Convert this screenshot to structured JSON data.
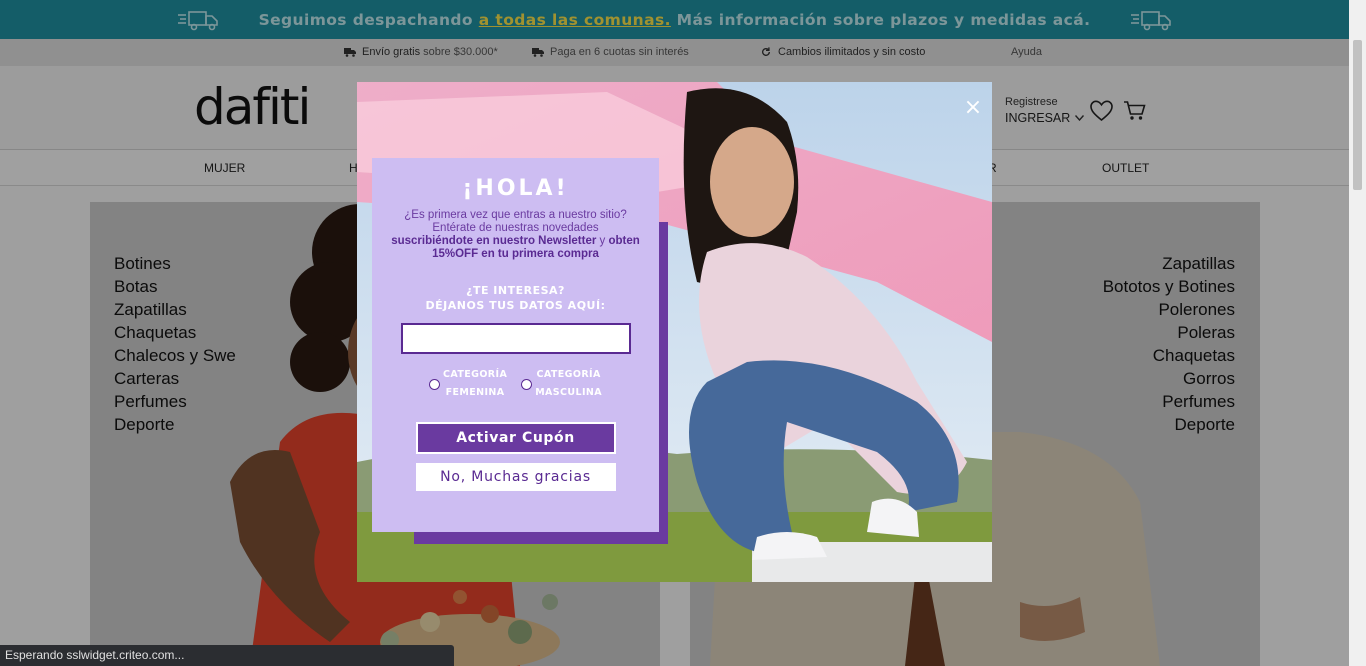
{
  "promo": {
    "text_before": "Seguimos despachando ",
    "link": "a todas las comunas.",
    "text_after": " Más información sobre plazos y medidas acá.",
    "icon": "truck-icon",
    "colors": {
      "background": "#1f8fa0",
      "link": "#f6e04a"
    }
  },
  "service": {
    "shipping_bold": "Envío gratis",
    "shipping_rest": " sobre $30.000*",
    "installments": "Paga en 6 cuotas sin interés",
    "returns": "Cambios ilimitados y sin costo",
    "help": "Ayuda"
  },
  "header": {
    "logo": "dafiti",
    "register": "Registrese",
    "login": "INGRESAR"
  },
  "nav": {
    "mujer": "MUJER",
    "h_partial": "H",
    "r_partial": "R",
    "outlet": "OUTLET"
  },
  "categories": {
    "women": [
      "Botines",
      "Botas",
      "Zapatillas",
      "Chaquetas",
      "Chalecos y Swe",
      "Carteras",
      "Perfumes",
      "Deporte"
    ],
    "men": [
      "Zapatillas",
      "Bototos y Botines",
      "Polerones",
      "Poleras",
      "Chaquetas",
      "Gorros",
      "Perfumes",
      "Deporte"
    ]
  },
  "modal": {
    "close": "×",
    "hola": "¡HOLA!",
    "intro_line1": "¿Es primera vez que entras a nuestro sitio?",
    "intro_line2": "Entérate de nuestras novedades",
    "intro_bold1": "suscribiéndote en nuestro Newsletter",
    "intro_mid": " y ",
    "intro_bold2": "obten",
    "intro_bold3": "15%OFF en tu primera compra",
    "question_line1": "¿TE INTERESA?",
    "question_line2": "DÉJANOS TUS DATOS AQUÍ:",
    "email_value": "",
    "option_female_1": "CATEGORÍA",
    "option_female_2": "FEMENINA",
    "option_male_1": "CATEGORÍA",
    "option_male_2": "MASCULINA",
    "activate": "Activar Cupón",
    "decline": "No, Muchas gracias",
    "colors": {
      "card": "#cdbdf2",
      "accent": "#6a3aa0"
    }
  },
  "status": "Esperando sslwidget.criteo.com..."
}
